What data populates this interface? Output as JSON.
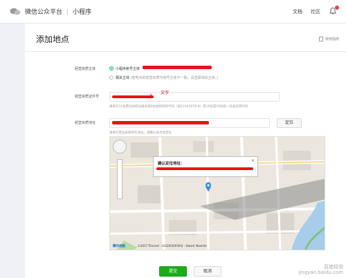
{
  "topbar": {
    "brand": "微信公众平台",
    "separator": "|",
    "product": "小程序",
    "doc_link": "文档",
    "community_link": "社区",
    "notification_count": "1"
  },
  "page": {
    "title": "添加地点",
    "help_link": "使用指南"
  },
  "form": {
    "subject_label": "经营资质主体",
    "subject_options": [
      {
        "label": "小程序帐号主体",
        "selected": true
      },
      {
        "label": "相关主体",
        "hint": "(若地点的经营资质与帐号主体不一致，请选择相关主体。)",
        "selected": false
      }
    ],
    "license_label": "经营资质证件号",
    "license_annotation": "X",
    "license_annotation_note": "文字",
    "license_note": "请填写15位营业执照注册号或9位组织机构代码（如12345678-9）或18位或20位统一社会信用代码",
    "address_label": "经营资质地址",
    "locate_button": "定位",
    "address_note": "请填写营业执照所在地址，请确认地点后定位"
  },
  "map": {
    "popup_title": "确认定位地址：",
    "copyright": "©2017 Tencent - GS(2016)930号 - Data© NavInfo",
    "provider": "腾讯地图"
  },
  "actions": {
    "submit": "提交",
    "cancel": "取消"
  },
  "watermark": {
    "line1": "百度经验",
    "line2": "jingyan.baidu.com"
  },
  "colors": {
    "brand_green": "#1aad19",
    "radio_green": "#07c160",
    "redaction_red": "#e8131c",
    "map_pin_blue": "#3a8ee6"
  }
}
